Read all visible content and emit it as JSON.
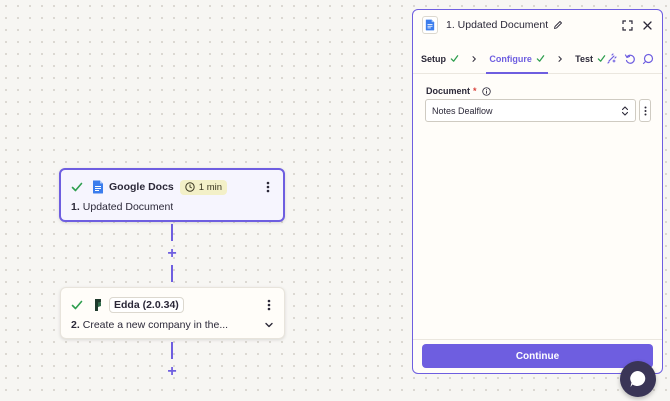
{
  "steps": [
    {
      "app_name": "Google Docs",
      "time_badge": "1 min",
      "number": "1.",
      "title": "Updated Document",
      "status": "complete",
      "icon": "google-docs-icon"
    },
    {
      "app_name": "Edda (2.0.34)",
      "number": "2.",
      "title": "Create a new company in the...",
      "status": "complete",
      "icon": "edda-icon"
    }
  ],
  "panel": {
    "title": "1. Updated Document",
    "tabs": [
      {
        "label": "Setup",
        "complete": true
      },
      {
        "label": "Configure",
        "complete": true,
        "active": true
      },
      {
        "label": "Test",
        "complete": true
      }
    ],
    "field": {
      "label": "Document",
      "required_mark": "*",
      "value": "Notes Dealflow"
    },
    "continue_label": "Continue"
  },
  "colors": {
    "accent": "#6e5ee0",
    "success": "#2e9e4f",
    "canvas": "#f7f6f3",
    "chat": "#3a3557"
  }
}
